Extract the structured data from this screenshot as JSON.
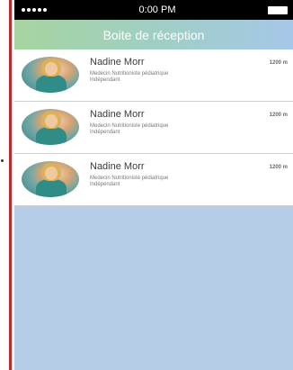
{
  "status_bar": {
    "time": "0:00 PM"
  },
  "header": {
    "title": "Boite de réception"
  },
  "messages": [
    {
      "name": "Nadine Morr",
      "specialty": "Medecin Nutritioniste pédiatrique",
      "status": "Indépendant",
      "distance": "1200 m"
    },
    {
      "name": "Nadine Morr",
      "specialty": "Medecin Nutritioniste pédiatrique",
      "status": "Indépendant",
      "distance": "1200 m"
    },
    {
      "name": "Nadine Morr",
      "specialty": "Medecin Nutritioniste pédiatrique",
      "status": "Indépendant",
      "distance": "1200 m"
    }
  ]
}
